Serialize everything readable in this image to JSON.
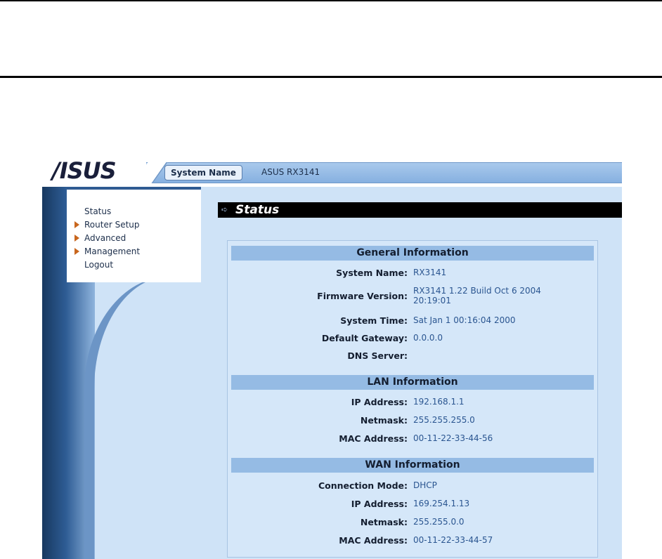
{
  "header": {
    "logo_text": "/ISUS",
    "system_name_label": "System Name",
    "system_name_value": "ASUS RX3141"
  },
  "menu": {
    "items": [
      {
        "label": "Status",
        "arrow": false
      },
      {
        "label": "Router Setup",
        "arrow": true
      },
      {
        "label": "Advanced",
        "arrow": true
      },
      {
        "label": "Management",
        "arrow": true
      },
      {
        "label": "Logout",
        "arrow": false
      }
    ]
  },
  "section": {
    "title": "Status"
  },
  "general": {
    "heading": "General Information",
    "system_name_label": "System Name:",
    "system_name_value": "RX3141",
    "firmware_label": "Firmware Version:",
    "firmware_value": "RX3141 1.22 Build Oct 6 2004 20:19:01",
    "system_time_label": "System Time:",
    "system_time_value": "Sat Jan 1 00:16:04 2000",
    "gateway_label": "Default Gateway:",
    "gateway_value": "0.0.0.0",
    "dns_label": "DNS Server:",
    "dns_value": ""
  },
  "lan": {
    "heading": "LAN Information",
    "ip_label": "IP Address:",
    "ip_value": "192.168.1.1",
    "netmask_label": "Netmask:",
    "netmask_value": "255.255.255.0",
    "mac_label": "MAC Address:",
    "mac_value": "00-11-22-33-44-56"
  },
  "wan": {
    "heading": "WAN Information",
    "mode_label": "Connection Mode:",
    "mode_value": "DHCP",
    "ip_label": "IP Address:",
    "ip_value": "169.254.1.13",
    "netmask_label": "Netmask:",
    "netmask_value": "255.255.0.0",
    "mac_label": "MAC Address:",
    "mac_value": "00-11-22-33-44-57"
  },
  "colors": {
    "accent_blue": "#95bbe4",
    "content_bg": "#cfe3f7",
    "menu_arrow": "#c8661d",
    "value_text": "#2a5590"
  }
}
